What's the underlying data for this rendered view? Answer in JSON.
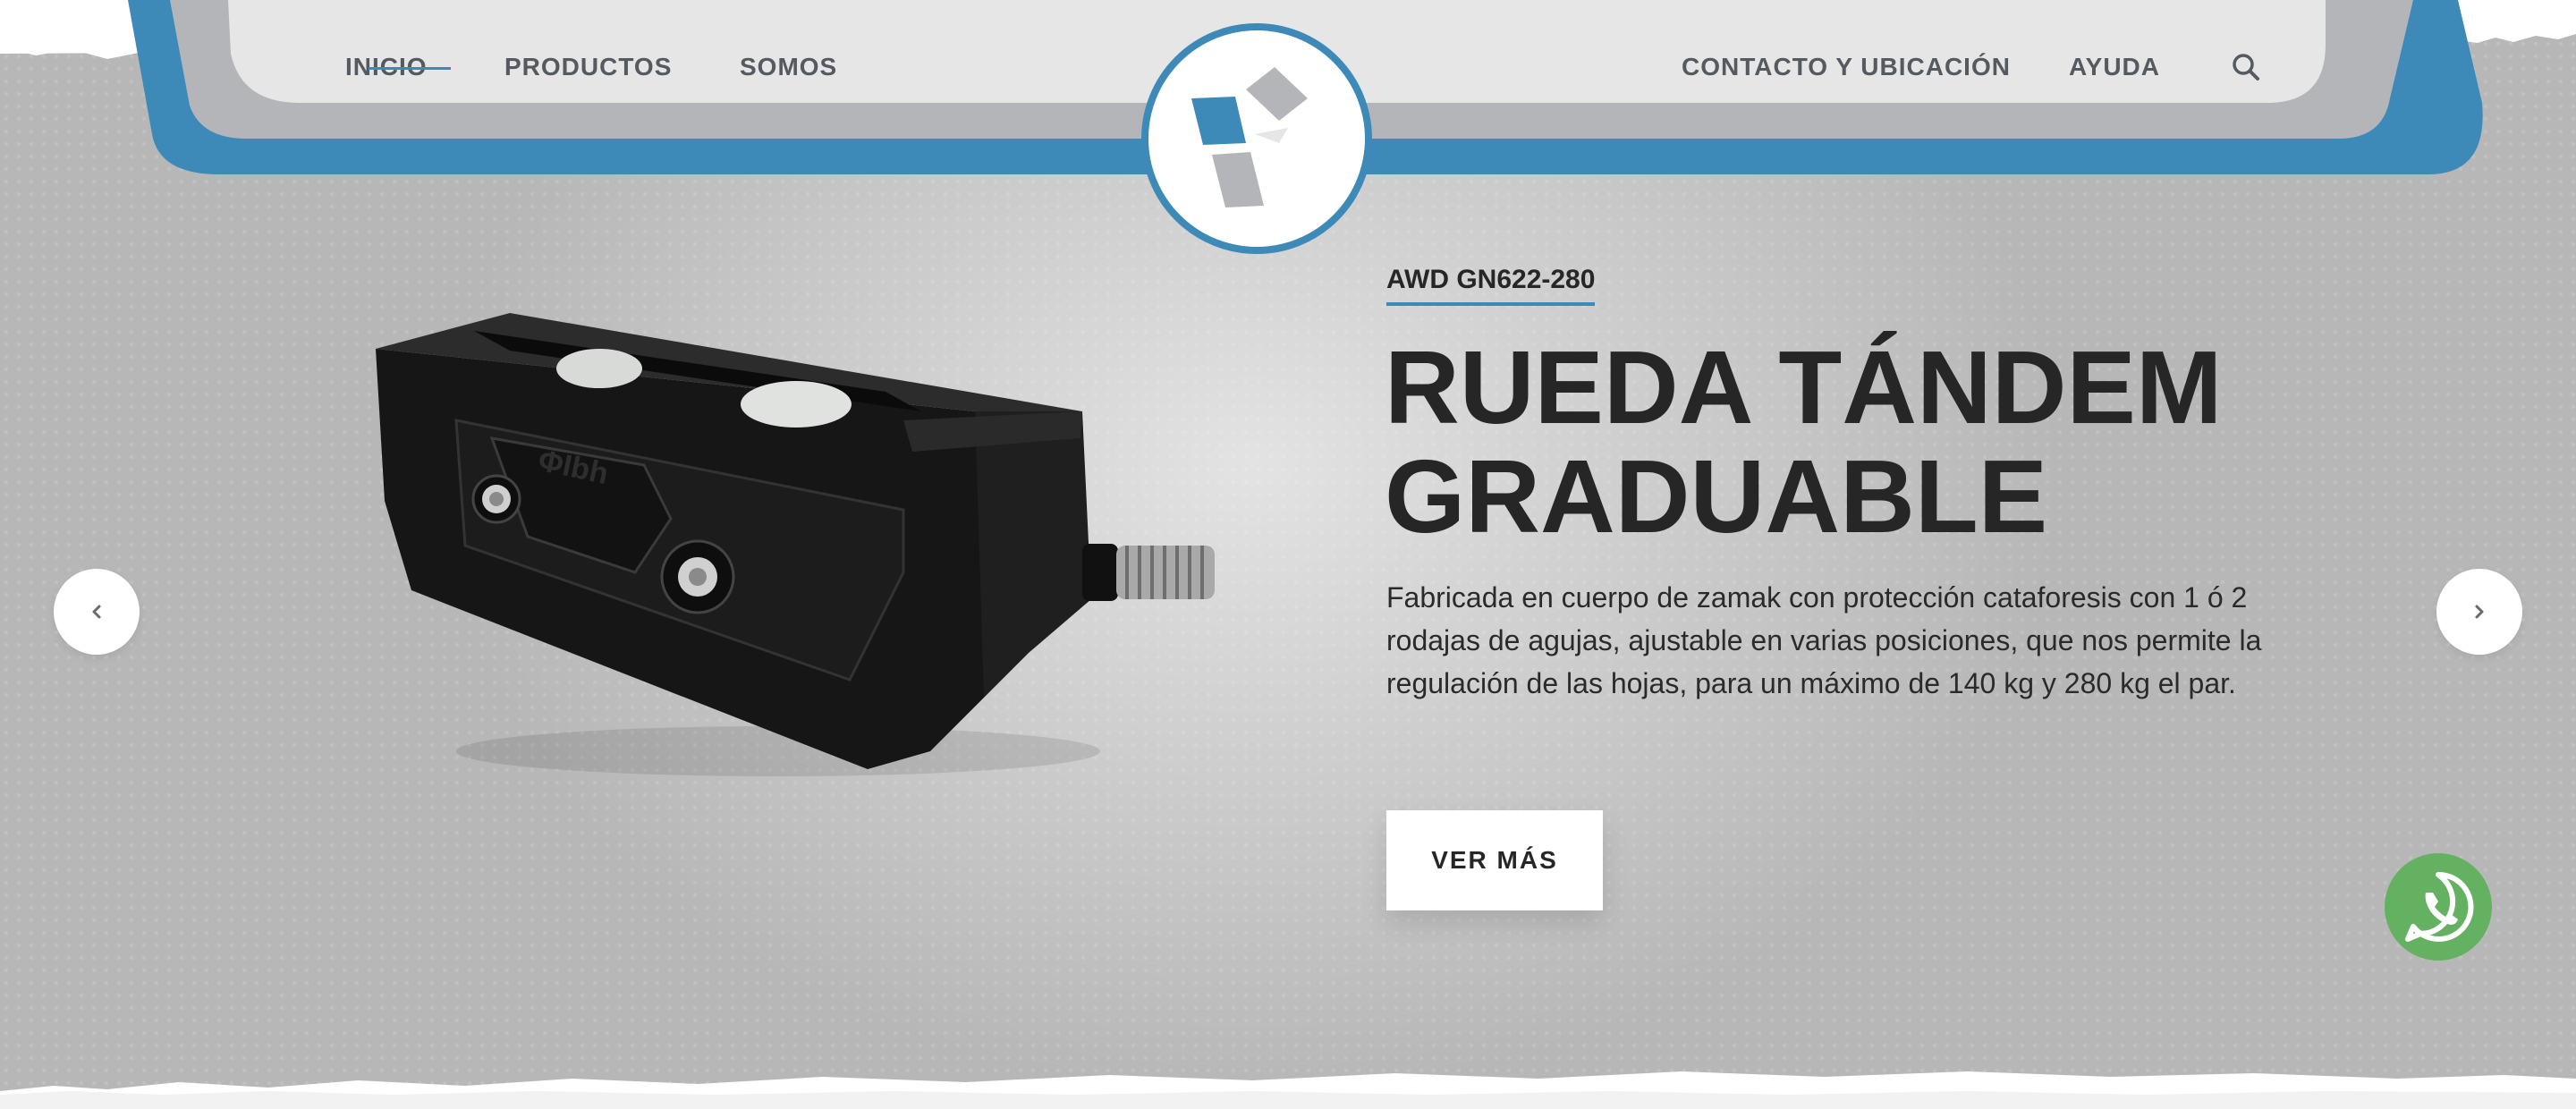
{
  "nav": {
    "left_items": [
      {
        "label": "INICIO",
        "active": true
      },
      {
        "label": "PRODUCTOS",
        "active": false
      },
      {
        "label": "SOMOS",
        "active": false
      }
    ],
    "right_items": [
      {
        "label": "CONTACTO Y UBICACIÓN"
      },
      {
        "label": "AYUDA"
      }
    ],
    "search_icon": "search-icon",
    "logo_icon": "brand-logo"
  },
  "slide": {
    "code": "AWD GN622-280",
    "title_line1": "RUEDA TÁNDEM",
    "title_line2": "GRADUABLE",
    "description": "Fabricada en cuerpo de zamak con protección cataforesis con 1 ó 2 rodajas de agujas, ajustable en varias posiciones, que nos permite la regulación de las hojas, para un máximo de 140 kg y 280 kg el par.",
    "button_label": "VER MÁS",
    "product_emboss": "ΦIbh"
  },
  "carousel": {
    "prev_icon": "chevron-left-icon",
    "next_icon": "chevron-right-icon"
  },
  "whatsapp": {
    "icon": "whatsapp-icon"
  },
  "colors": {
    "brand_blue": "#3d8ab8",
    "frame_gray": "#b4b5b9",
    "header_bg": "#e6e6e6",
    "text_dark": "#262626",
    "whatsapp_green": "#64b161"
  }
}
